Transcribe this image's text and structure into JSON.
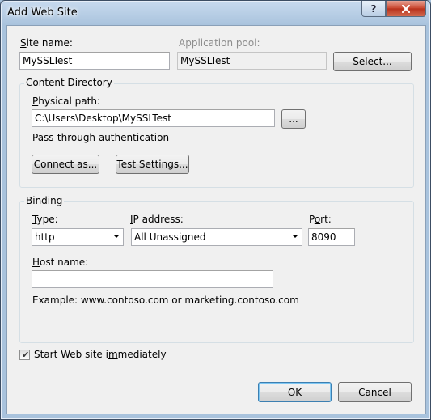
{
  "window": {
    "title": "Add Web Site",
    "help_label": "?",
    "close_label": "x"
  },
  "site": {
    "site_name_label": "Site name:",
    "site_name_value": "MySSLTest",
    "app_pool_label": "Application pool:",
    "app_pool_value": "MySSLTest",
    "select_label": "Select..."
  },
  "content_directory": {
    "group_label": "Content Directory",
    "physical_path_label": "Physical path:",
    "physical_path_value": "C:\\Users\\Desktop\\MySSLTest",
    "browse_label": "...",
    "passthrough_label": "Pass-through authentication",
    "connect_as_label": "Connect as...",
    "test_settings_label": "Test Settings..."
  },
  "binding": {
    "group_label": "Binding",
    "type_label": "Type:",
    "type_value": "http",
    "ip_label": "IP address:",
    "ip_value": "All Unassigned",
    "port_label": "Port:",
    "port_value": "8090",
    "host_label": "Host name:",
    "host_value": "",
    "example_text": "Example: www.contoso.com or marketing.contoso.com"
  },
  "start_immediately": {
    "label": "Start Web site immediately",
    "checked": true
  },
  "footer": {
    "ok_label": "OK",
    "cancel_label": "Cancel"
  }
}
